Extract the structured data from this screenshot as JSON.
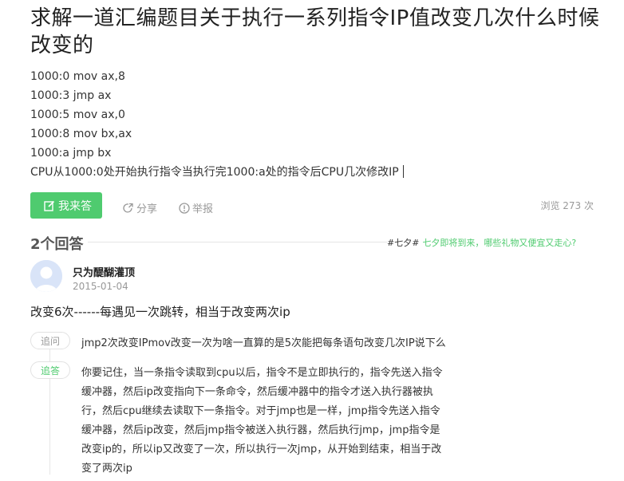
{
  "question": {
    "title": "求解一道汇编题目关于执行一系列指令IP值改变几次什么时候改变的",
    "lines": [
      "1000:0 mov ax,8",
      "1000:3 jmp ax",
      "1000:5 mov ax,0",
      "1000:8 mov bx,ax",
      "1000:a jmp bx",
      "CPU从1000:0处开始执行指令当执行完1000:a处的指令后CPU几次修改IP"
    ]
  },
  "actions": {
    "answer_label": "我来答",
    "share_label": "分享",
    "report_label": "举报",
    "views": "浏览 273 次"
  },
  "answers": {
    "count_label": "2个回答",
    "promo_tag": "#七夕#",
    "promo_text": "七夕即将到来，哪些礼物又便宜又走心?"
  },
  "answer": {
    "username": "只为醍醐灌顶",
    "date": "2015-01-04",
    "text": "改变6次------每遇见一次跳转，相当于改变两次ip",
    "followup_label": "追问",
    "followup_text": "jmp2次改变IPmov改变一次为啥一直算的是5次能把每条语句改变几次IP说下么",
    "reply_label": "追答",
    "reply_lines": [
      "你要记住，当一条指令读取到cpu以后，指令不是立即执行的，指令先送入指令",
      "缓冲器，然后ip改变指向下一条命令，然后缓冲器中的指令才送入执行器被执",
      "行，然后cpu继续去读取下一条指令。对于jmp也是一样，jmp指令先送入指令",
      "缓冲器，然后ip改变，然后jmp指令被送入执行器，然后执行jmp，jmp指令是",
      "改变ip的，所以ip又改变了一次，所以执行一次jmp，从开始到结束，相当于改",
      "变了两次ip"
    ]
  },
  "colors": {
    "accent": "#4fcb6f",
    "muted": "#999999",
    "text": "#333333"
  },
  "icons": [
    "edit-icon",
    "share-icon",
    "report-icon",
    "avatar-placeholder"
  ]
}
